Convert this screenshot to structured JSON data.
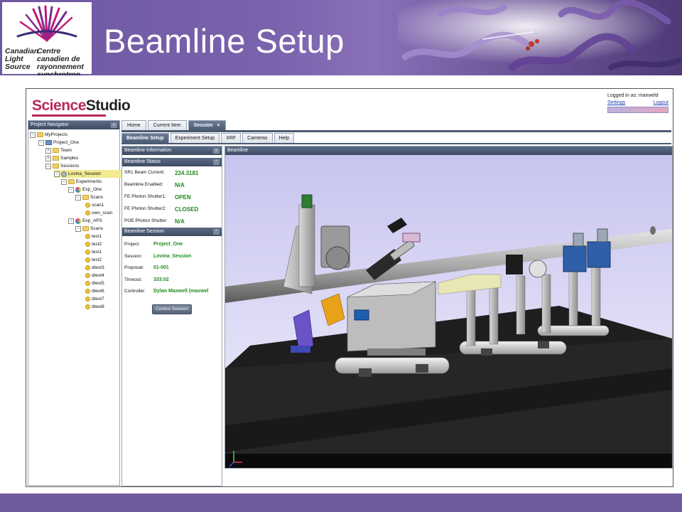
{
  "slide": {
    "title": "Beamline Setup",
    "logo_en": "Canadian Light Source",
    "logo_fr": "Centre canadien de rayonnement synchrotron"
  },
  "app": {
    "logo_part1": "Science",
    "logo_part2": "Studio",
    "login_text": "Logged in as: maxweld",
    "settings_link": "Settings",
    "logout_link": "Logout"
  },
  "navigator": {
    "title": "Project Navigator",
    "tree": [
      {
        "label": "MyProjects",
        "icon": "folder-icon"
      },
      {
        "label": "Project_One",
        "icon": "book-icon"
      },
      {
        "label": "Team",
        "icon": "folder-icon"
      },
      {
        "label": "Samples",
        "icon": "folder-icon"
      },
      {
        "label": "Sessions",
        "icon": "folder-icon"
      },
      {
        "label": "Lovina_Session",
        "icon": "session-icon",
        "selected": true
      },
      {
        "label": "Experiments",
        "icon": "folder-icon"
      },
      {
        "label": "Exp_One",
        "icon": "experiment-icon"
      },
      {
        "label": "Scans",
        "icon": "folder-icon"
      },
      {
        "label": "scan1",
        "icon": "scan-icon"
      },
      {
        "label": "uwo_scan",
        "icon": "scan-icon"
      },
      {
        "label": "Exp_APS",
        "icon": "experiment-icon"
      },
      {
        "label": "Scans",
        "icon": "folder-icon"
      },
      {
        "label": "test1",
        "icon": "scan-icon"
      },
      {
        "label": "test2",
        "icon": "scan-icon"
      },
      {
        "label": "test1",
        "icon": "scan-icon"
      },
      {
        "label": "test2",
        "icon": "scan-icon"
      },
      {
        "label": "dtest3",
        "icon": "scan-icon"
      },
      {
        "label": "dtest4",
        "icon": "scan-icon"
      },
      {
        "label": "dtest5",
        "icon": "scan-icon"
      },
      {
        "label": "dtest6",
        "icon": "scan-icon"
      },
      {
        "label": "dtest7",
        "icon": "scan-icon"
      },
      {
        "label": "dtest8",
        "icon": "scan-icon"
      }
    ]
  },
  "tabs": {
    "main": [
      "Home",
      "Current Item",
      "Session"
    ],
    "close_glyph": "×",
    "sub": [
      "Beamline Setup",
      "Experiment Setup",
      "XRF",
      "Cameras",
      "Help"
    ]
  },
  "info_panel": {
    "info_title": "Beamline Information",
    "status_title": "Beamline Status",
    "status_rows": [
      {
        "label": "SR1 Beam Current:",
        "value": "224.3181"
      },
      {
        "label": "Beamline Enabled:",
        "value": "N/A"
      },
      {
        "label": "FE Photon Shutter1:",
        "value": "OPEN"
      },
      {
        "label": "FE Photon Shutter2:",
        "value": "CLOSED"
      },
      {
        "label": "POE Photon Shutter:",
        "value": "N/A"
      }
    ],
    "session_title": "Beamline Session",
    "session_rows": [
      {
        "label": "Project:",
        "value": "Project_One"
      },
      {
        "label": "Session:",
        "value": "Lovina_Session"
      },
      {
        "label": "Propsoal:",
        "value": "01-001"
      },
      {
        "label": "Timeout:",
        "value": "333:02"
      },
      {
        "label": "Controller:",
        "value": "Dylan Maxwell (maxwel"
      }
    ],
    "control_button": "Control Session"
  },
  "beamline": {
    "title": "Beamline"
  },
  "colors": {
    "slide_purple": "#6f5a9c",
    "panel_header": "#4b5a72",
    "status_green": "#1f8b1f",
    "selected_row": "#f1ea8f",
    "brand_magenta": "#b8285a"
  }
}
